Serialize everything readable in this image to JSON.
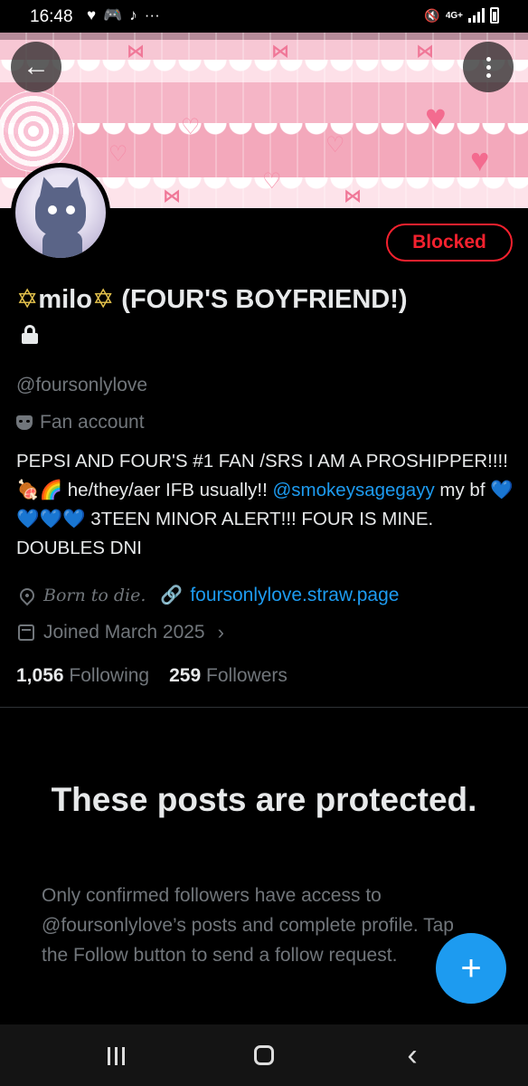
{
  "status_bar": {
    "time": "16:48",
    "left_icons": [
      "heart-icon",
      "gamepad-icon",
      "music-icon",
      "more-icon"
    ],
    "more_glyph": "···",
    "network_label": "4G+",
    "right_icons": [
      "mute-icon",
      "network-4g-icon",
      "signal-icon",
      "battery-icon"
    ]
  },
  "header": {
    "back_icon": "arrow-left-icon",
    "more_icon": "more-vertical-icon"
  },
  "profile": {
    "blocked_label": "Blocked",
    "name_star": "✡",
    "name_main": "milo",
    "name_rest": " (FOUR'S BOYFRIEND!)",
    "locked": true,
    "handle": "@foursonlylove",
    "category": "Fan account",
    "bio_part1": "PEPSI AND FOUR'S #1 FAN /SRS I AM A PROSHIPPER!!!! 🍖🌈 he/they/aer IFB usually!! ",
    "bio_mention": "@smokeysagegayy",
    "bio_part2": " my bf 💙💙💙💙 3TEEN MINOR ALERT!!! FOUR IS MINE. DOUBLES DNI",
    "location": "Born to die.",
    "link": "foursonlylove.straw.page",
    "joined": "Joined March 2025",
    "following_count": "1,056",
    "following_label": "Following",
    "followers_count": "259",
    "followers_label": "Followers"
  },
  "protected": {
    "title": "These posts are protected.",
    "text": "Only confirmed followers have access to @foursonlylove’s posts and complete profile. Tap the Follow button to send a follow request."
  },
  "fab": {
    "icon": "plus-icon",
    "glyph": "+"
  },
  "navbar": {
    "items": [
      "recent-apps-icon",
      "home-icon",
      "back-icon"
    ],
    "back_glyph": "‹"
  },
  "colors": {
    "accent": "#1d9bf0",
    "blocked": "#f4212e",
    "muted": "#71767b",
    "text": "#e7e9ea"
  }
}
